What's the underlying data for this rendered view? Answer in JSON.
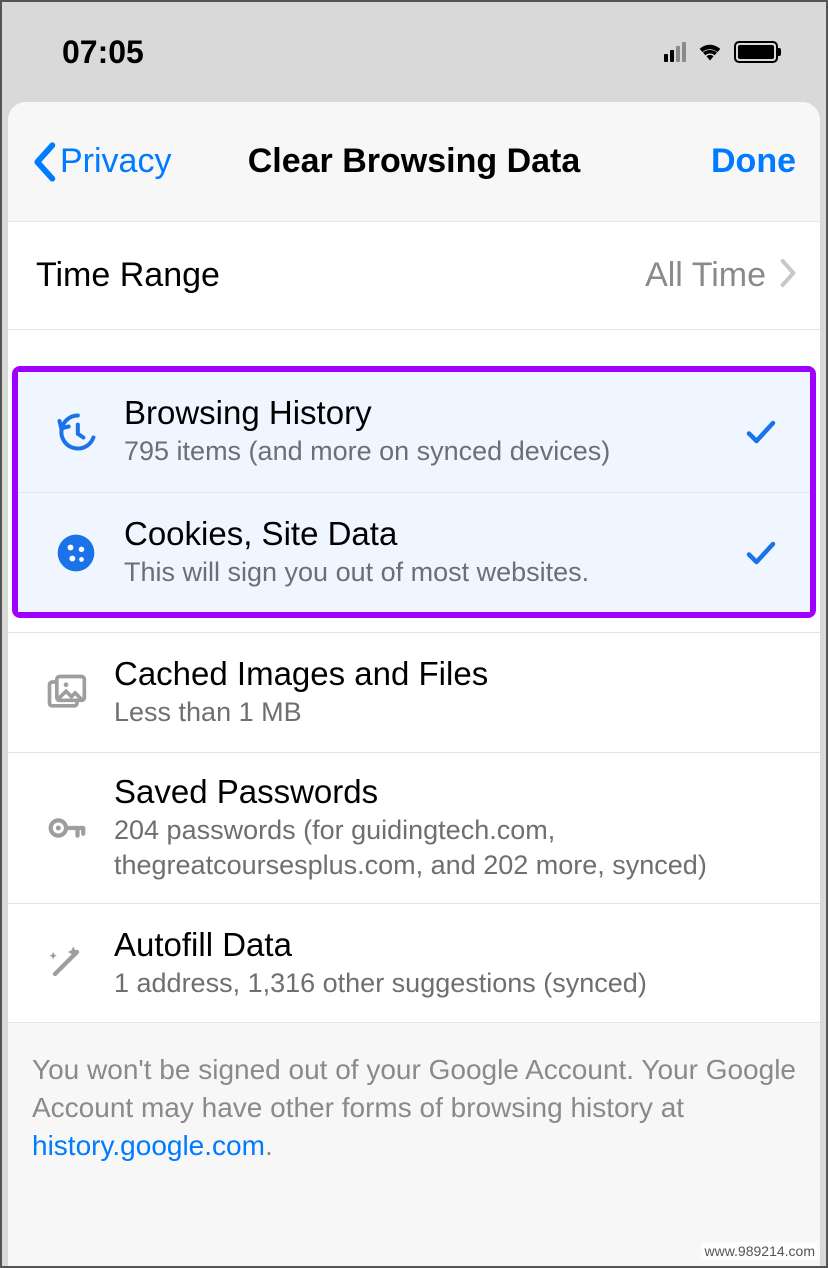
{
  "status": {
    "time": "07:05"
  },
  "nav": {
    "back_label": "Privacy",
    "title": "Clear Browsing Data",
    "done_label": "Done"
  },
  "time_range": {
    "label": "Time Range",
    "value": "All Time"
  },
  "items": [
    {
      "title": "Browsing History",
      "subtitle": "795 items (and more on synced devices)",
      "checked": true,
      "icon": "history"
    },
    {
      "title": "Cookies, Site Data",
      "subtitle": "This will sign you out of most websites.",
      "checked": true,
      "icon": "cookie"
    },
    {
      "title": "Cached Images and Files",
      "subtitle": "Less than 1 MB",
      "checked": false,
      "icon": "images"
    },
    {
      "title": "Saved Passwords",
      "subtitle": "204 passwords (for guidingtech.com, thegreatcoursesplus.com, and 202 more, synced)",
      "checked": false,
      "icon": "key"
    },
    {
      "title": "Autofill Data",
      "subtitle": "1 address, 1,316 other suggestions (synced)",
      "checked": false,
      "icon": "wand"
    }
  ],
  "footer": {
    "text_before": "You won't be signed out of your Google Account. Your Google Account may have other forms of browsing history at ",
    "link_text": "history.google.com",
    "text_after": "."
  },
  "watermark": "www.989214.com"
}
